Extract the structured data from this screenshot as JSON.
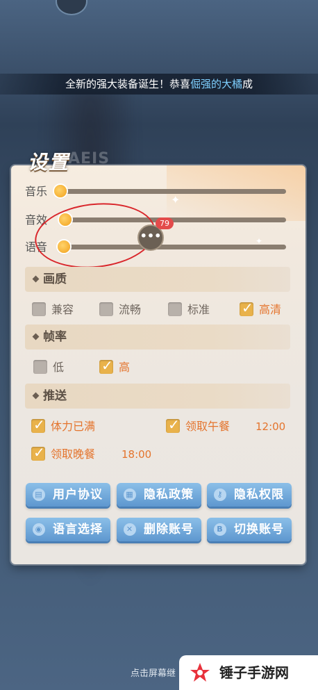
{
  "banner": {
    "prefix": "全新的强大装备诞生！恭喜",
    "highlight": "倔强的大橘",
    "suffix": "成"
  },
  "settings": {
    "title": "设置",
    "title_ghost": "AEIS"
  },
  "sliders": [
    {
      "label": "音乐",
      "level": 0
    },
    {
      "label": "音效",
      "level": 0.02
    },
    {
      "label": "语音",
      "level": 0.01
    }
  ],
  "chat": {
    "icon": "chat-bubble-icon",
    "badge": "79",
    "glyph": "•••"
  },
  "quality": {
    "header": "画质",
    "options": [
      {
        "label": "兼容",
        "checked": false
      },
      {
        "label": "流畅",
        "checked": false
      },
      {
        "label": "标准",
        "checked": false
      },
      {
        "label": "高清",
        "checked": true
      }
    ]
  },
  "framerate": {
    "header": "帧率",
    "options": [
      {
        "label": "低",
        "checked": false
      },
      {
        "label": "高",
        "checked": true
      }
    ]
  },
  "push": {
    "header": "推送",
    "items": [
      {
        "label": "体力已满",
        "checked": true,
        "time": ""
      },
      {
        "label": "领取午餐",
        "checked": true,
        "time": "12:00"
      },
      {
        "label": "领取晚餐",
        "checked": true,
        "time": "18:00"
      }
    ]
  },
  "buttons": [
    {
      "label": "用户协议",
      "icon": "document-icon"
    },
    {
      "label": "隐私政策",
      "icon": "grid-icon"
    },
    {
      "label": "隐私权限",
      "icon": "key-icon"
    },
    {
      "label": "语言选择",
      "icon": "speech-icon"
    },
    {
      "label": "删除账号",
      "icon": "close-circle-icon"
    },
    {
      "label": "切换账号",
      "icon": "account-icon"
    }
  ],
  "bottom_hint": "点击屏幕继",
  "watermark": {
    "text": "锤子手游网"
  },
  "colors": {
    "accent_orange": "#e4742d",
    "checkbox_checked": "#e9b24b",
    "button_blue": "#5e97cf",
    "annotation_red": "#d9262b"
  }
}
